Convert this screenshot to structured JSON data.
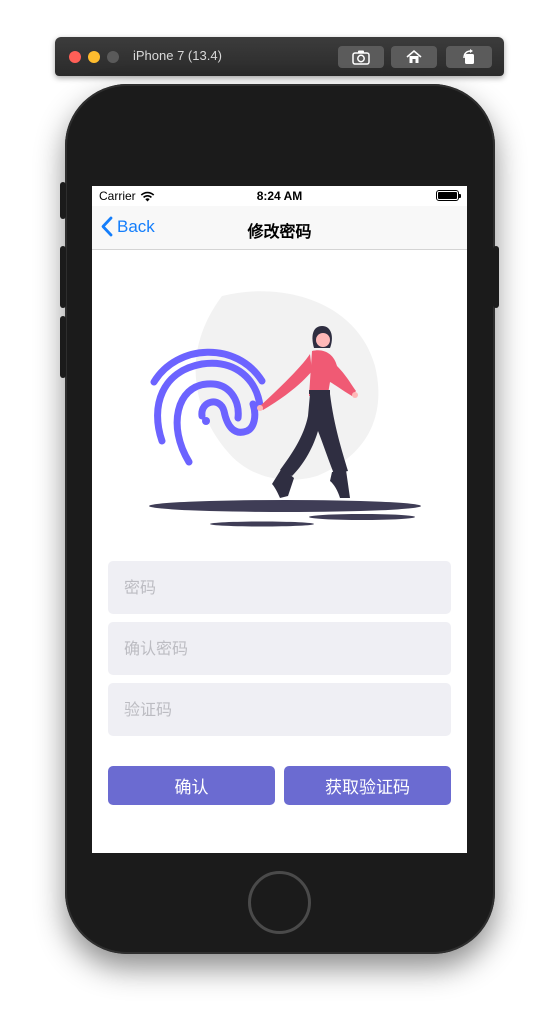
{
  "simulator": {
    "title": "iPhone 7 (13.4)",
    "buttons": [
      "screenshot-icon",
      "home-icon",
      "rotate-icon"
    ]
  },
  "status_bar": {
    "carrier": "Carrier",
    "time": "8:24 AM"
  },
  "nav": {
    "back_label": "Back",
    "title": "修改密码"
  },
  "form": {
    "password_placeholder": "密码",
    "confirm_password_placeholder": "确认密码",
    "verification_code_placeholder": "验证码"
  },
  "actions": {
    "confirm_label": "确认",
    "get_code_label": "获取验证码"
  },
  "colors": {
    "accent": "#6b6bd1",
    "ios_blue": "#147efb",
    "fingerprint": "#6c63ff",
    "figure_top": "#f05a74",
    "input_bg": "#efeff4"
  }
}
